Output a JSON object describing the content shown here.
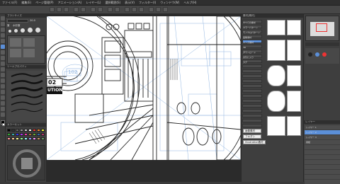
{
  "menu": {
    "items": [
      "ファイル(F)",
      "編集(E)",
      "ページ管理(P)",
      "アニメーション(A)",
      "レイヤー(L)",
      "選択範囲(S)",
      "表示(V)",
      "フィルター(I)",
      "ウィンドウ(W)",
      "ヘルプ(H)"
    ]
  },
  "subtool": {
    "header": "ブラシサイズ",
    "brush_label": "筆",
    "brush_label2": "水彩筆",
    "panel2_header": "ツールプロパティ",
    "panel3_header": "カラーセット",
    "size_value": "20.0"
  },
  "canvas": {
    "sign_text": "02",
    "sign_text2": "UTION",
    "door_number": "102"
  },
  "nav": {
    "header": "素材[素材]",
    "tree_items": [
      "すべての素材",
      "カラーパターン",
      "モノクロパターン",
      "画像素材",
      "マンガ素材",
      "3D",
      "ダウンロード",
      "お気に入り",
      "タグ"
    ],
    "button1": "画像素材",
    "button2": "フキダシ",
    "button3": "Illustration素材"
  },
  "right": {
    "layer_header": "レイヤー",
    "layers": [
      "レイヤー 1",
      "レイヤー 2",
      "レイヤー 3",
      "用紙"
    ]
  },
  "colors": {
    "accent": "#5b8fd8",
    "panel_bg": "#404040",
    "menubar_bg": "#2f2f2f",
    "sketch_blue": "#8fb4e0"
  }
}
